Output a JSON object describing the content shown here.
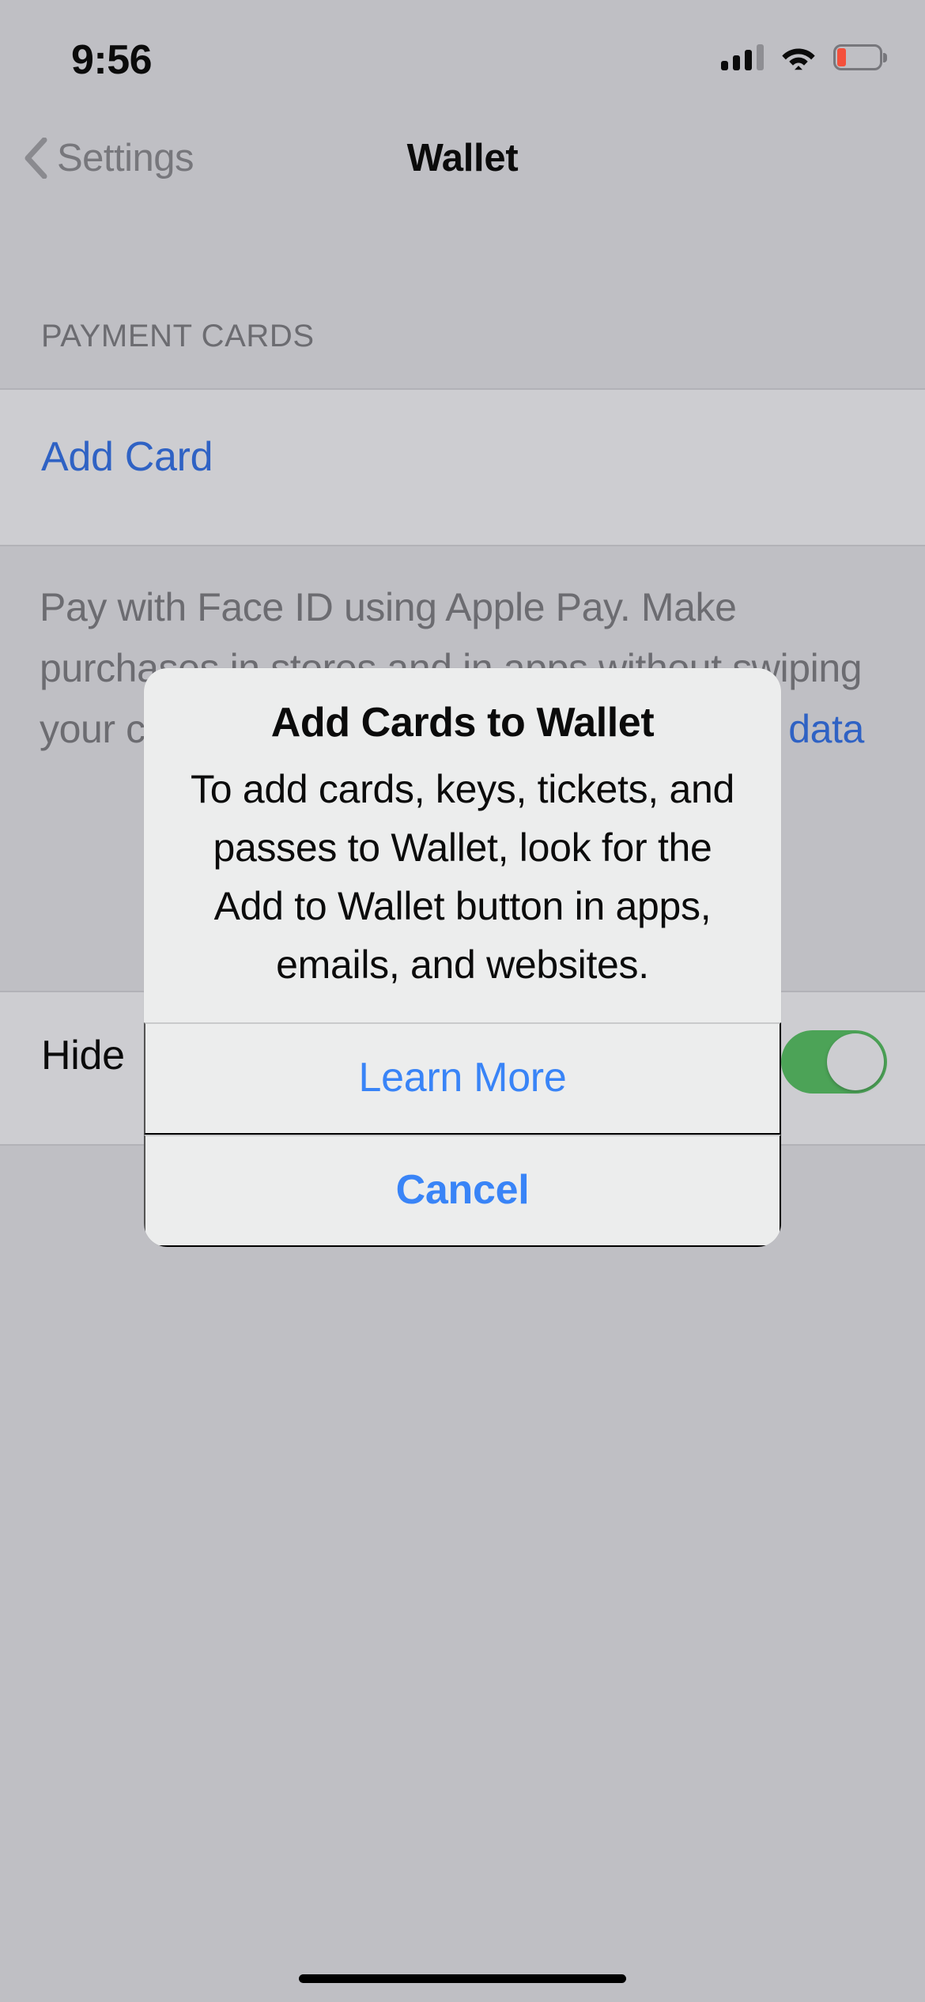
{
  "status_bar": {
    "time": "9:56",
    "cellular_icon": "cellular-bars-icon",
    "cellular_bars_filled": 3,
    "cellular_bars_total": 4,
    "wifi_icon": "wifi-icon",
    "battery_icon": "battery-low-icon",
    "battery_level_percent": 15,
    "battery_color": "#f4503c"
  },
  "nav": {
    "back_label": "Settings",
    "back_icon": "chevron-left-icon",
    "title": "Wallet"
  },
  "content": {
    "section_header": "PAYMENT CARDS",
    "add_card_label": "Add Card",
    "footer": {
      "part1": "Pay with Face ID using Apple Pay. Make purchases in stores and in apps without swiping your card and share your data without ",
      "link": "your data",
      "part2": ""
    },
    "hide_row": {
      "label": "Hide",
      "toggle_state": "on",
      "toggle_on_color": "#4ca357"
    }
  },
  "alert": {
    "title": "Add Cards to Wallet",
    "message": "To add cards, keys, tickets, and passes to Wallet, look for the Add to Wallet button in apps, emails, and websites.",
    "learn_more_label": "Learn More",
    "cancel_label": "Cancel",
    "accent_color": "#3984f7"
  },
  "home_indicator": "home-indicator"
}
